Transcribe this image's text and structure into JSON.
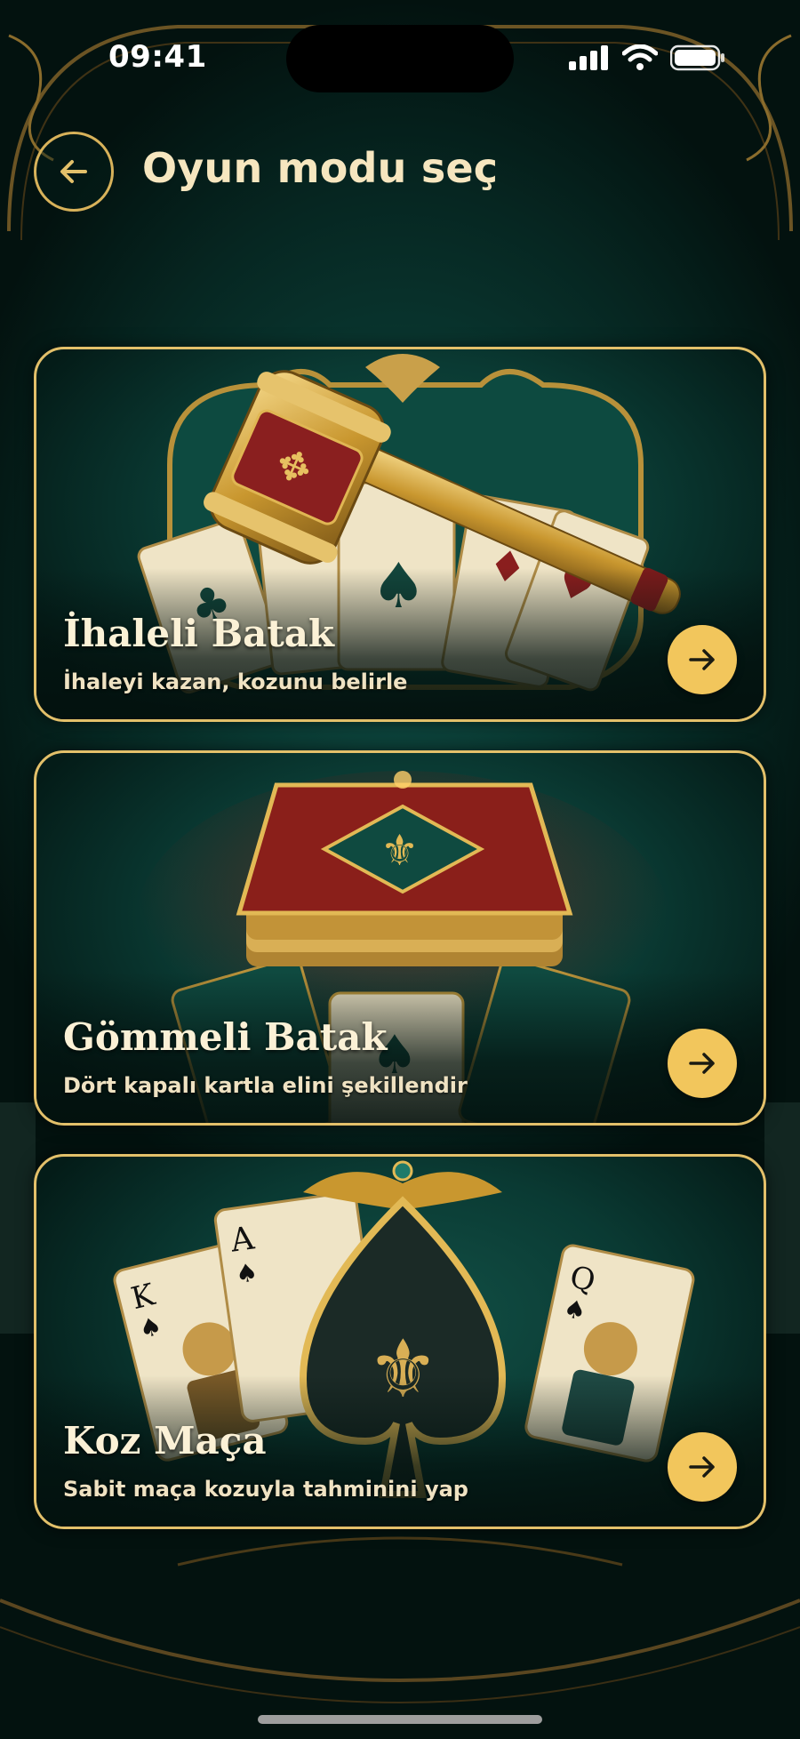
{
  "status_bar": {
    "time": "09:41",
    "icons": [
      "cellular-signal-icon",
      "wifi-icon",
      "battery-icon"
    ]
  },
  "header": {
    "back_icon": "arrow-left-icon",
    "title": "Oyun modu seç"
  },
  "modes": [
    {
      "title": "İhaleli Batak",
      "subtitle": "İhaleyi kazan, kozunu belirle",
      "art": "gavel-over-cards",
      "action_icon": "arrow-right-icon"
    },
    {
      "title": "Gömmeli Batak",
      "subtitle": "Dört kapalı kartla elini şekillendir",
      "art": "card-deck-stack",
      "action_icon": "arrow-right-icon"
    },
    {
      "title": "Koz Maça",
      "subtitle": "Sabit maça kozuyla tahminini yap",
      "art": "spade-emblem-with-king-ace-queen",
      "card_corner_marks": {
        "king": "K",
        "ace": "A",
        "queen": "Q"
      },
      "action_icon": "arrow-right-icon"
    }
  ],
  "colors": {
    "accent_gold": "#e3c06a",
    "button_gold": "#f2c65c",
    "felt_green": "#0a3a33",
    "title_cream": "#f6e6bf"
  }
}
